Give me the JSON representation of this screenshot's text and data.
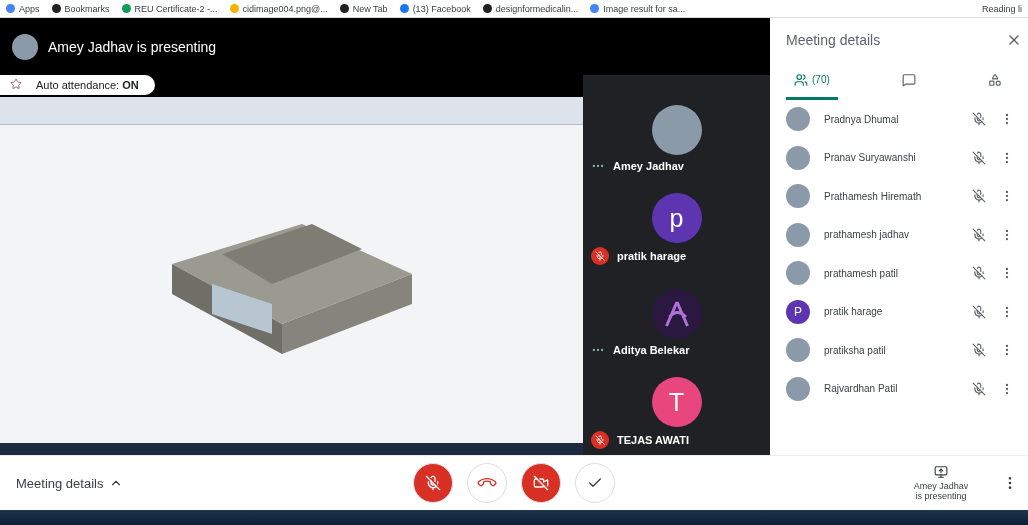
{
  "bookmarks": [
    {
      "label": "Apps",
      "color": "#4285f4"
    },
    {
      "label": "Bookmarks",
      "color": "#202124"
    },
    {
      "label": "REU Certificate-2 -...",
      "color": "#0f9d58"
    },
    {
      "label": "cidimage004.png@...",
      "color": "#f4b400"
    },
    {
      "label": "New Tab",
      "color": "#202124"
    },
    {
      "label": "(13) Facebook",
      "color": "#1877f2"
    },
    {
      "label": "designformedicalin...",
      "color": "#202124"
    },
    {
      "label": "Image result for sa...",
      "color": "#4285f4"
    }
  ],
  "reading_list": "Reading li",
  "presenter_banner": "Amey Jadhav is presenting",
  "auto_attendance": "Auto attendance: **ON**",
  "tiles": [
    {
      "name": "Amey Jadhav",
      "muted": false,
      "avatar": {
        "kind": "photo"
      }
    },
    {
      "name": "pratik harage",
      "muted": true,
      "avatar": {
        "kind": "letter",
        "letter": "p",
        "color": "#5e35b1"
      }
    },
    {
      "name": "Aditya Belekar",
      "muted": false,
      "avatar": {
        "kind": "logo"
      }
    },
    {
      "name": "TEJAS AWATI",
      "muted": true,
      "avatar": {
        "kind": "letter",
        "letter": "T",
        "color": "#e8467c"
      }
    }
  ],
  "panel": {
    "title": "Meeting details",
    "tabs": [
      {
        "kind": "people",
        "count": "(70)",
        "selected": true
      },
      {
        "kind": "chat",
        "selected": false
      },
      {
        "kind": "activities",
        "selected": false
      }
    ],
    "people": [
      {
        "name": "Pradnya Dhumal",
        "muted": true,
        "avatar": {
          "kind": "photo"
        }
      },
      {
        "name": "Pranav Suryawanshi",
        "muted": true,
        "avatar": {
          "kind": "photo"
        }
      },
      {
        "name": "Prathamesh Hiremath",
        "muted": true,
        "avatar": {
          "kind": "photo"
        }
      },
      {
        "name": "prathamesh jadhav",
        "muted": true,
        "avatar": {
          "kind": "photo"
        }
      },
      {
        "name": "prathamesh patil",
        "muted": true,
        "avatar": {
          "kind": "photo"
        }
      },
      {
        "name": "pratik harage",
        "muted": true,
        "avatar": {
          "kind": "letter",
          "letter": "P",
          "color": "#5e35b1"
        }
      },
      {
        "name": "pratiksha patil",
        "muted": true,
        "avatar": {
          "kind": "photo"
        }
      },
      {
        "name": "Rajvardhan Patil",
        "muted": true,
        "avatar": {
          "kind": "photo"
        }
      }
    ]
  },
  "bottom_bar": {
    "details_label": "Meeting details",
    "mic_on": false,
    "camera_on": false,
    "presenting_label": "Amey Jadhav is presenting"
  }
}
